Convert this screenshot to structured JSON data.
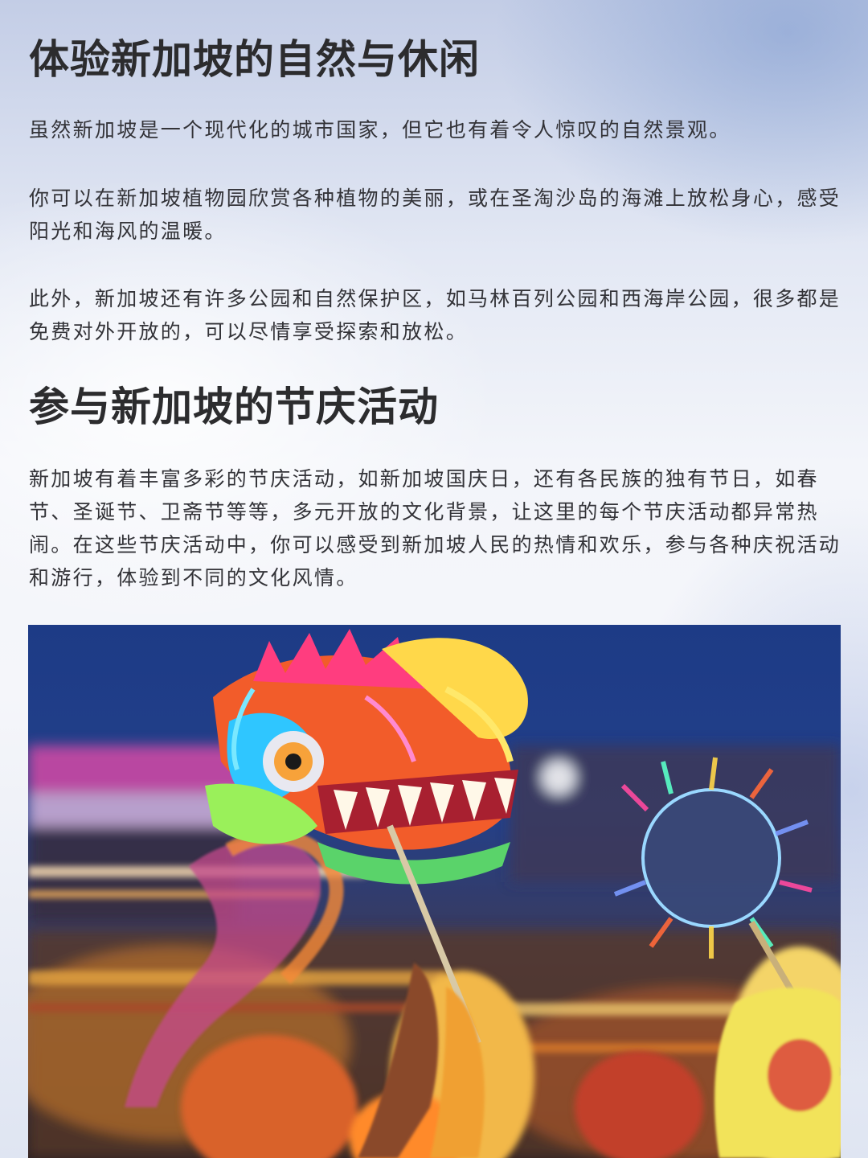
{
  "sections": [
    {
      "title": "体验新加坡的自然与休闲",
      "paragraphs": [
        "虽然新加坡是一个现代化的城市国家，但它也有着令人惊叹的自然景观。",
        "你可以在新加坡植物园欣赏各种植物的美丽，或在圣淘沙岛的海滩上放松身心，感受阳光和海风的温暖。",
        "此外，新加坡还有许多公园和自然保护区，如马林百列公园和西海岸公园，很多都是免费对外开放的，可以尽情享受探索和放松。"
      ]
    },
    {
      "title": "参与新加坡的节庆活动",
      "paragraphs": [
        "新加坡有着丰富多彩的节庆活动，如新加坡国庆日，还有各民族的独有节日，如春节、圣诞节、卫斋节等等，多元开放的文化背景，让这里的每个节庆活动都异常热闹。在这些节庆活动中，你可以感受到新加坡人民的热情和欢乐，参与各种庆祝活动和游行，体验到不同的文化风情。"
      ]
    }
  ],
  "photo": {
    "subject": "dragon-dance-photo"
  }
}
